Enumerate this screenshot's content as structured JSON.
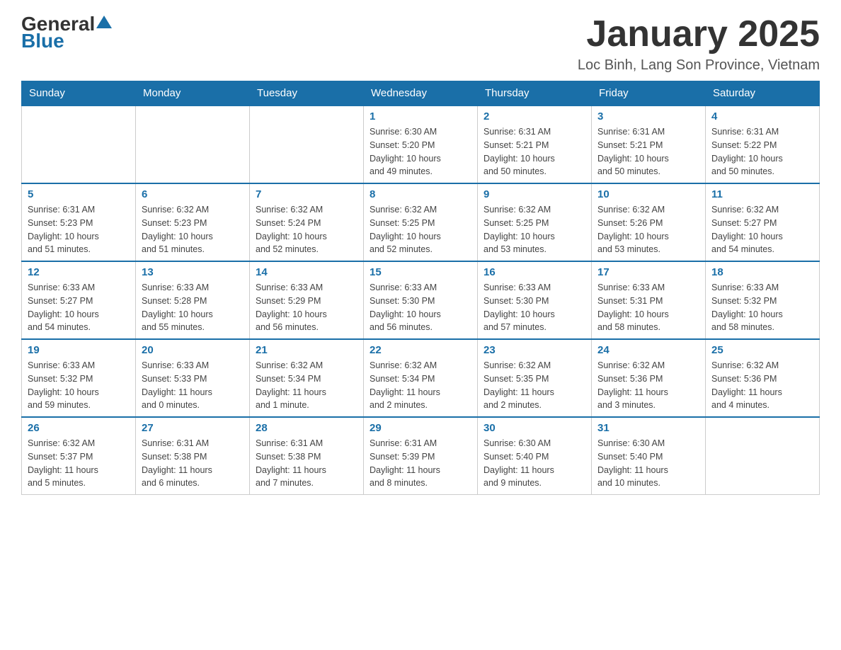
{
  "logo": {
    "text_general": "General",
    "text_blue": "Blue"
  },
  "header": {
    "title": "January 2025",
    "subtitle": "Loc Binh, Lang Son Province, Vietnam"
  },
  "days_of_week": [
    "Sunday",
    "Monday",
    "Tuesday",
    "Wednesday",
    "Thursday",
    "Friday",
    "Saturday"
  ],
  "weeks": [
    [
      {
        "day": "",
        "info": ""
      },
      {
        "day": "",
        "info": ""
      },
      {
        "day": "",
        "info": ""
      },
      {
        "day": "1",
        "info": "Sunrise: 6:30 AM\nSunset: 5:20 PM\nDaylight: 10 hours\nand 49 minutes."
      },
      {
        "day": "2",
        "info": "Sunrise: 6:31 AM\nSunset: 5:21 PM\nDaylight: 10 hours\nand 50 minutes."
      },
      {
        "day": "3",
        "info": "Sunrise: 6:31 AM\nSunset: 5:21 PM\nDaylight: 10 hours\nand 50 minutes."
      },
      {
        "day": "4",
        "info": "Sunrise: 6:31 AM\nSunset: 5:22 PM\nDaylight: 10 hours\nand 50 minutes."
      }
    ],
    [
      {
        "day": "5",
        "info": "Sunrise: 6:31 AM\nSunset: 5:23 PM\nDaylight: 10 hours\nand 51 minutes."
      },
      {
        "day": "6",
        "info": "Sunrise: 6:32 AM\nSunset: 5:23 PM\nDaylight: 10 hours\nand 51 minutes."
      },
      {
        "day": "7",
        "info": "Sunrise: 6:32 AM\nSunset: 5:24 PM\nDaylight: 10 hours\nand 52 minutes."
      },
      {
        "day": "8",
        "info": "Sunrise: 6:32 AM\nSunset: 5:25 PM\nDaylight: 10 hours\nand 52 minutes."
      },
      {
        "day": "9",
        "info": "Sunrise: 6:32 AM\nSunset: 5:25 PM\nDaylight: 10 hours\nand 53 minutes."
      },
      {
        "day": "10",
        "info": "Sunrise: 6:32 AM\nSunset: 5:26 PM\nDaylight: 10 hours\nand 53 minutes."
      },
      {
        "day": "11",
        "info": "Sunrise: 6:32 AM\nSunset: 5:27 PM\nDaylight: 10 hours\nand 54 minutes."
      }
    ],
    [
      {
        "day": "12",
        "info": "Sunrise: 6:33 AM\nSunset: 5:27 PM\nDaylight: 10 hours\nand 54 minutes."
      },
      {
        "day": "13",
        "info": "Sunrise: 6:33 AM\nSunset: 5:28 PM\nDaylight: 10 hours\nand 55 minutes."
      },
      {
        "day": "14",
        "info": "Sunrise: 6:33 AM\nSunset: 5:29 PM\nDaylight: 10 hours\nand 56 minutes."
      },
      {
        "day": "15",
        "info": "Sunrise: 6:33 AM\nSunset: 5:30 PM\nDaylight: 10 hours\nand 56 minutes."
      },
      {
        "day": "16",
        "info": "Sunrise: 6:33 AM\nSunset: 5:30 PM\nDaylight: 10 hours\nand 57 minutes."
      },
      {
        "day": "17",
        "info": "Sunrise: 6:33 AM\nSunset: 5:31 PM\nDaylight: 10 hours\nand 58 minutes."
      },
      {
        "day": "18",
        "info": "Sunrise: 6:33 AM\nSunset: 5:32 PM\nDaylight: 10 hours\nand 58 minutes."
      }
    ],
    [
      {
        "day": "19",
        "info": "Sunrise: 6:33 AM\nSunset: 5:32 PM\nDaylight: 10 hours\nand 59 minutes."
      },
      {
        "day": "20",
        "info": "Sunrise: 6:33 AM\nSunset: 5:33 PM\nDaylight: 11 hours\nand 0 minutes."
      },
      {
        "day": "21",
        "info": "Sunrise: 6:32 AM\nSunset: 5:34 PM\nDaylight: 11 hours\nand 1 minute."
      },
      {
        "day": "22",
        "info": "Sunrise: 6:32 AM\nSunset: 5:34 PM\nDaylight: 11 hours\nand 2 minutes."
      },
      {
        "day": "23",
        "info": "Sunrise: 6:32 AM\nSunset: 5:35 PM\nDaylight: 11 hours\nand 2 minutes."
      },
      {
        "day": "24",
        "info": "Sunrise: 6:32 AM\nSunset: 5:36 PM\nDaylight: 11 hours\nand 3 minutes."
      },
      {
        "day": "25",
        "info": "Sunrise: 6:32 AM\nSunset: 5:36 PM\nDaylight: 11 hours\nand 4 minutes."
      }
    ],
    [
      {
        "day": "26",
        "info": "Sunrise: 6:32 AM\nSunset: 5:37 PM\nDaylight: 11 hours\nand 5 minutes."
      },
      {
        "day": "27",
        "info": "Sunrise: 6:31 AM\nSunset: 5:38 PM\nDaylight: 11 hours\nand 6 minutes."
      },
      {
        "day": "28",
        "info": "Sunrise: 6:31 AM\nSunset: 5:38 PM\nDaylight: 11 hours\nand 7 minutes."
      },
      {
        "day": "29",
        "info": "Sunrise: 6:31 AM\nSunset: 5:39 PM\nDaylight: 11 hours\nand 8 minutes."
      },
      {
        "day": "30",
        "info": "Sunrise: 6:30 AM\nSunset: 5:40 PM\nDaylight: 11 hours\nand 9 minutes."
      },
      {
        "day": "31",
        "info": "Sunrise: 6:30 AM\nSunset: 5:40 PM\nDaylight: 11 hours\nand 10 minutes."
      },
      {
        "day": "",
        "info": ""
      }
    ]
  ]
}
